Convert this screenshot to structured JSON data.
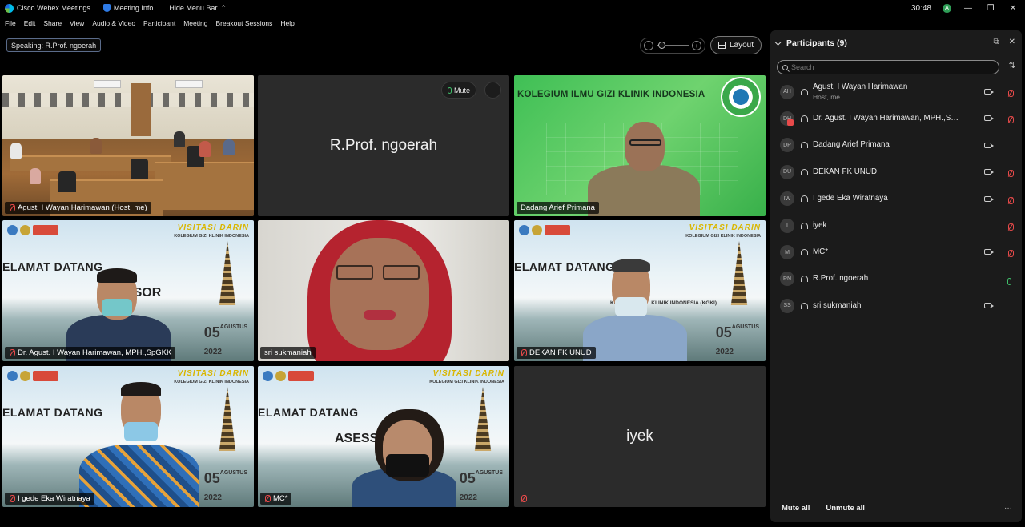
{
  "titlebar": {
    "app_name": "Cisco Webex Meetings",
    "meeting_info": "Meeting Info",
    "hide_menu": "Hide Menu Bar",
    "time": "30:48",
    "status_initial": "A"
  },
  "menu": [
    "File",
    "Edit",
    "Share",
    "View",
    "Audio & Video",
    "Participant",
    "Meeting",
    "Breakout Sessions",
    "Help"
  ],
  "speaking": {
    "label": "Speaking:",
    "name": "R.Prof. ngoerah"
  },
  "layout_button": "Layout",
  "tile_actions": {
    "mute": "Mute",
    "more": "···"
  },
  "tiles": [
    {
      "name": "Agust. I Wayan Harimawan (Host, me)",
      "muted": true
    },
    {
      "name": "R.Prof. ngoerah",
      "muted": false
    },
    {
      "name": "Dadang Arief Primana",
      "muted": false,
      "banner": "KOLEGIUM ILMU GIZI KLINIK INDONESIA"
    },
    {
      "name": "Dr. Agust. I Wayan Harimawan, MPH.,SpGKK",
      "muted": true
    },
    {
      "name": "sri sukmaniah",
      "muted": false
    },
    {
      "name": "DEKAN FK UNUD",
      "muted": true
    },
    {
      "name": "I gede Eka Wiratnaya",
      "muted": true
    },
    {
      "name": "MC*",
      "muted": true
    },
    {
      "name": "iyek",
      "muted": true
    }
  ],
  "banner": {
    "visitasi": "VISITASI DARIN",
    "kolegium": "KOLEGIUM GIZI KLINIK INDONESIA",
    "selamat": "ELAMAT DATANG",
    "asesor": "ASESSOR",
    "kgki": "KOLEGIUM GIZI KLINIK INDONESIA (KGKI)",
    "date_day": "05",
    "date_month": "AGUSTUS",
    "date_year": "2022"
  },
  "panel": {
    "title": "Participants (9)",
    "search_placeholder": "Search",
    "participants": [
      {
        "initials": "AH",
        "name": "Agust. I Wayan Harimawan",
        "sub": "Host, me",
        "video": true,
        "mic": "muted"
      },
      {
        "initials": "DH",
        "name": "Dr. Agust. I Wayan Harimawan, MPH.,SpGKK",
        "sub": "",
        "video": true,
        "mic": "muted"
      },
      {
        "initials": "DP",
        "name": "Dadang Arief Primana",
        "sub": "",
        "video": true,
        "mic": "none"
      },
      {
        "initials": "DU",
        "name": "DEKAN FK UNUD",
        "sub": "",
        "video": true,
        "mic": "muted"
      },
      {
        "initials": "IW",
        "name": "I gede Eka Wiratnaya",
        "sub": "",
        "video": true,
        "mic": "muted"
      },
      {
        "initials": "I",
        "name": "iyek",
        "sub": "",
        "video": false,
        "mic": "muted"
      },
      {
        "initials": "M",
        "name": "MC*",
        "sub": "",
        "video": true,
        "mic": "muted"
      },
      {
        "initials": "RN",
        "name": "R.Prof. ngoerah",
        "sub": "",
        "video": false,
        "mic": "on"
      },
      {
        "initials": "SS",
        "name": "sri sukmaniah",
        "sub": "",
        "video": true,
        "mic": "none"
      }
    ],
    "mute_all": "Mute all",
    "unmute_all": "Unmute all",
    "more": "···"
  },
  "colors": {
    "accent_green": "#3fbf6a",
    "muted_red": "#e84a4a",
    "panel_bg": "#1b1b1b"
  }
}
